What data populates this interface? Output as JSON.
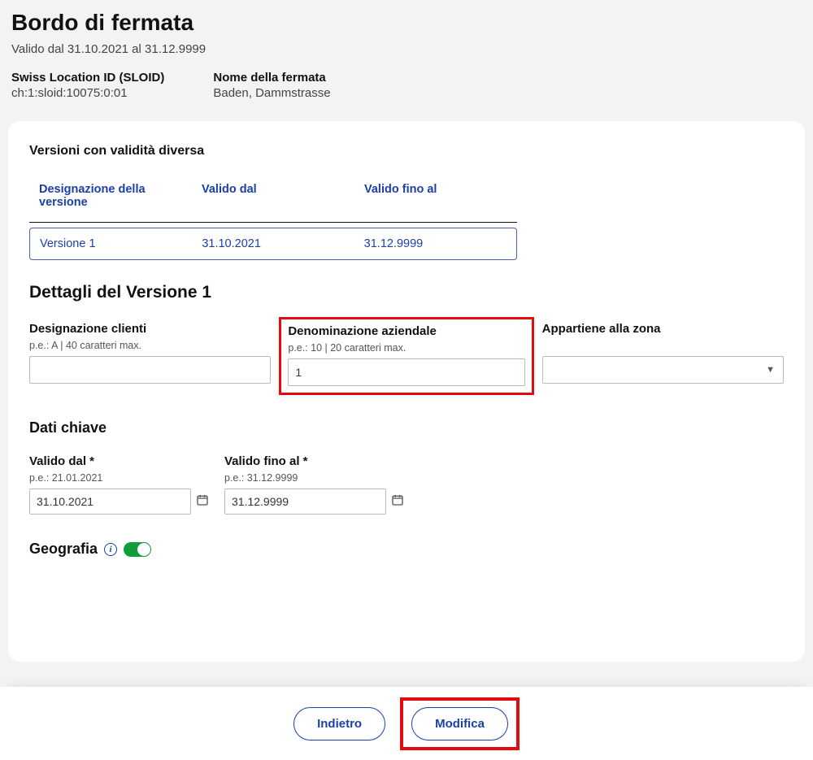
{
  "header": {
    "title": "Bordo di fermata",
    "validity": "Valido dal 31.10.2021 al 31.12.9999",
    "sloid_label": "Swiss Location ID (SLOID)",
    "sloid_value": "ch:1:sloid:10075:0:01",
    "stopname_label": "Nome della fermata",
    "stopname_value": "Baden, Dammstrasse"
  },
  "versions": {
    "section_title": "Versioni con validità diversa",
    "col_designazione": "Designazione della versione",
    "col_valido_dal": "Valido dal",
    "col_valido_fino": "Valido fino al",
    "row": {
      "designazione": "Versione 1",
      "valido_dal": "31.10.2021",
      "valido_fino": "31.12.9999"
    }
  },
  "details": {
    "heading": "Dettagli del Versione 1",
    "designazione_clienti": {
      "label": "Designazione clienti",
      "hint": "p.e.: A | 40 caratteri max.",
      "value": ""
    },
    "denominazione_aziendale": {
      "label": "Denominazione aziendale",
      "hint": "p.e.: 10 | 20 caratteri max.",
      "value": "1"
    },
    "appartiene_zona": {
      "label": "Appartiene alla zona",
      "value": ""
    }
  },
  "keydata": {
    "heading": "Dati chiave",
    "valido_dal": {
      "label": "Valido dal *",
      "hint": "p.e.: 21.01.2021",
      "value": "31.10.2021"
    },
    "valido_fino": {
      "label": "Valido fino al *",
      "hint": "p.e.: 31.12.9999",
      "value": "31.12.9999"
    }
  },
  "geografia": {
    "heading": "Geografia"
  },
  "footer": {
    "indietro": "Indietro",
    "modifica": "Modifica"
  }
}
